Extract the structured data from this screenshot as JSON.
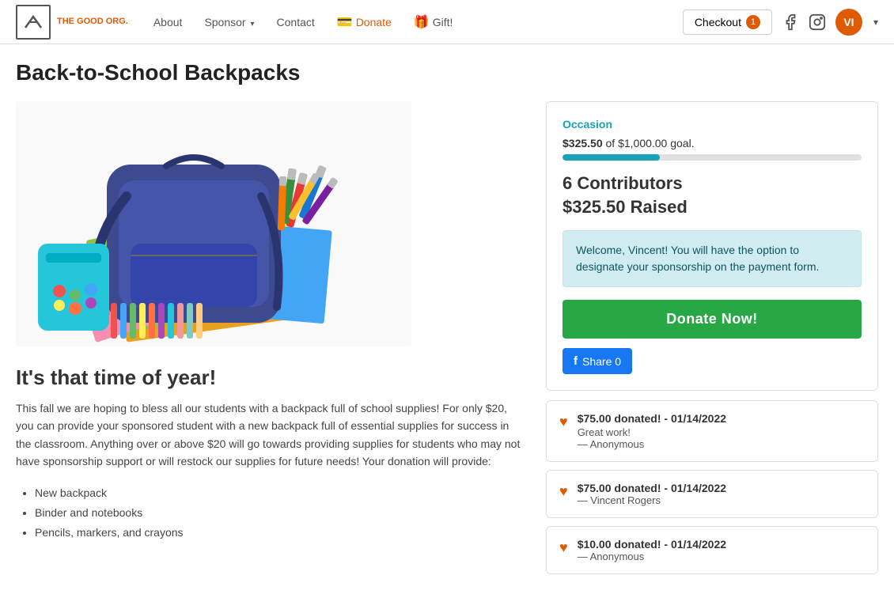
{
  "navbar": {
    "logo_text": "THE GOOD ORG.",
    "links": [
      {
        "label": "About",
        "id": "about"
      },
      {
        "label": "Sponsor",
        "id": "sponsor",
        "has_dropdown": true
      },
      {
        "label": "Contact",
        "id": "contact"
      },
      {
        "label": "Donate",
        "id": "donate",
        "has_icon": "card"
      },
      {
        "label": "Gift!",
        "id": "gift",
        "has_icon": "gift"
      }
    ],
    "checkout_label": "Checkout",
    "checkout_count": "1",
    "avatar_initials": "VI"
  },
  "page": {
    "title": "Back-to-School Backpacks"
  },
  "campaign": {
    "headline": "It's that time of year!",
    "body": "This fall we are hoping to bless all our students with a backpack full of school supplies! For only $20, you can provide your sponsored student with a new backpack full of essential supplies for success in the classroom. Anything over or above $20 will go towards providing supplies for students who may not have sponsorship support or will restock our supplies for future needs! Your donation will provide:",
    "list_items": [
      "New backpack",
      "Binder and notebooks",
      "Pencils, markers, and crayons"
    ]
  },
  "donation_panel": {
    "occasion_label": "Occasion",
    "current_amount": "$325.50",
    "goal_amount": "$1,000.00",
    "goal_text": "of $1,000.00 goal.",
    "progress_pct": 32.55,
    "contributors_text": "6 Contributors",
    "raised_text": "$325.50 Raised",
    "welcome_message": "Welcome, Vincent! You will have the option to designate your sponsorship on the payment form.",
    "donate_button_label": "Donate Now!",
    "fb_share_label": "Share 0"
  },
  "donation_cards": [
    {
      "amount": "$75.00 donated!",
      "date": " - 01/14/2022",
      "message": "Great work!",
      "donor": "— Anonymous"
    },
    {
      "amount": "$75.00 donated!",
      "date": " - 01/14/2022",
      "message": "",
      "donor": "— Vincent Rogers"
    },
    {
      "amount": "$10.00 donated!",
      "date": " - 01/14/2022",
      "message": "",
      "donor": "— Anonymous"
    }
  ]
}
